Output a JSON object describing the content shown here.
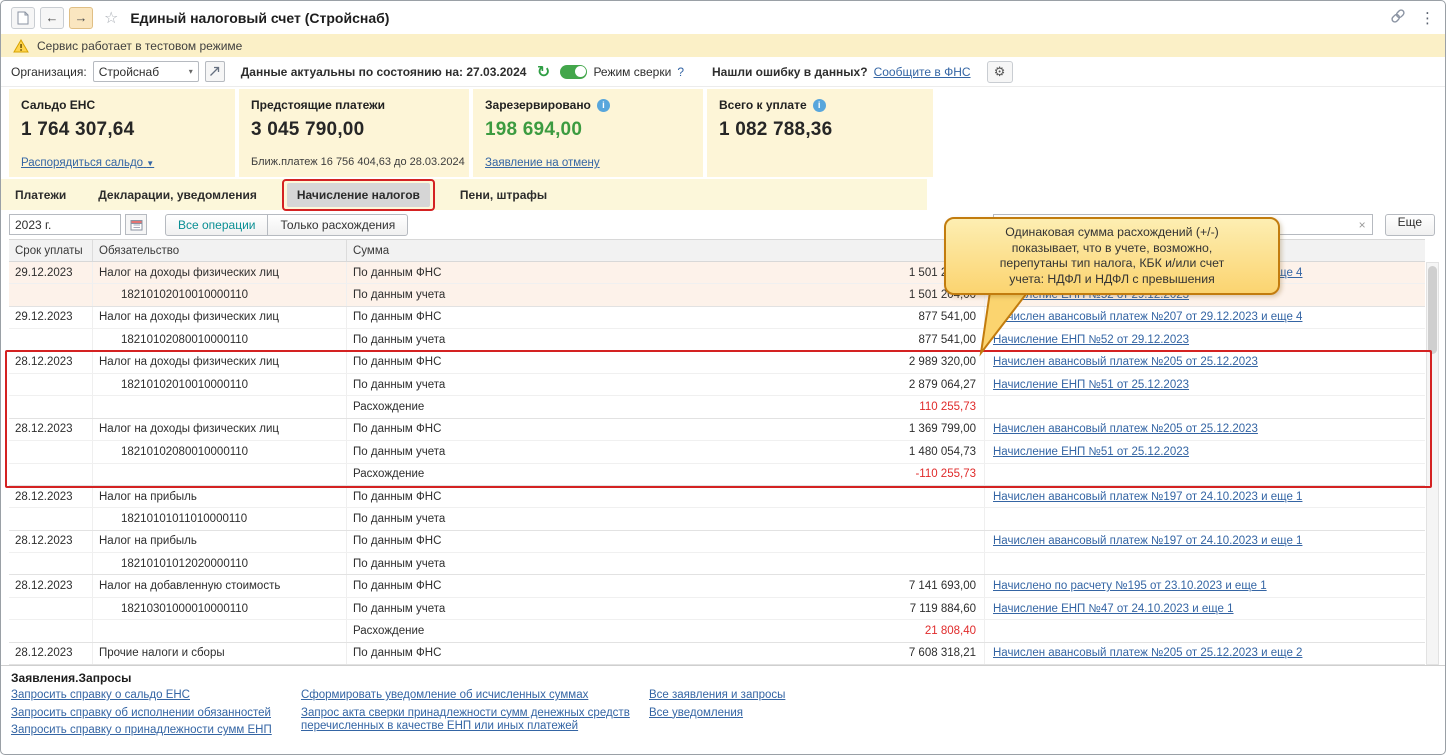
{
  "titlebar": {
    "title": "Единый налоговый счет (Стройснаб)"
  },
  "warning": {
    "text": "Сервис работает в тестовом режиме"
  },
  "toolbar": {
    "org_label": "Организация:",
    "org_value": "Стройснаб",
    "actuality_label": "Данные актуальны по состоянию на:",
    "actuality_date": "27.03.2024",
    "reconciliation_label": "Режим сверки",
    "reconciliation_help": "?",
    "error_question": "Нашли ошибку в данных?",
    "error_link": "Сообщите в ФНС"
  },
  "cards": {
    "balance": {
      "title": "Сальдо ЕНС",
      "value": "1 764 307,64",
      "action": "Распорядиться сальдо"
    },
    "upcoming": {
      "title": "Предстоящие платежи",
      "value": "3 045 790,00",
      "note": "Ближ.платеж 16 756 404,63 до 28.03.2024"
    },
    "reserved": {
      "title": "Зарезервировано",
      "value": "198 694,00",
      "action": "Заявление на отмену",
      "value_color": "#3c9b40"
    },
    "total": {
      "title": "Всего к уплате",
      "value": "1 082 788,36"
    }
  },
  "tabs": {
    "items": [
      "Платежи",
      "Декларации, уведомления",
      "Начисление налогов",
      "Пени, штрафы"
    ],
    "selected": "Начисление налогов"
  },
  "filters": {
    "period": "2023 г.",
    "all_operations": "Все операции",
    "only_differences": "Только расхождения",
    "search_value": "",
    "more_button": "Еще"
  },
  "table": {
    "columns": {
      "due": "Срок уплаты",
      "obligation": "Обязательство",
      "sum": "Сумма"
    },
    "groups": [
      {
        "date": "29.12.2023",
        "name": "Налог на доходы физических лиц",
        "kbk": "18210102010010000110",
        "rows": [
          {
            "label": "По данным ФНС",
            "amount": "1 501 204,00",
            "doc": "Начислен авансовый платеж №207 от 29.12.2023 и еще 4"
          },
          {
            "label": "По данным учета",
            "amount": "1 501 204,00",
            "doc": "Начисление ЕНП №52 от 29.12.2023"
          }
        ]
      },
      {
        "date": "29.12.2023",
        "name": "Налог на доходы физических лиц",
        "kbk": "18210102080010000110",
        "rows": [
          {
            "label": "По данным ФНС",
            "amount": "877 541,00",
            "doc": "Начислен авансовый платеж №207 от 29.12.2023 и еще 4"
          },
          {
            "label": "По данным учета",
            "amount": "877 541,00",
            "doc": "Начисление ЕНП №52 от 29.12.2023"
          }
        ]
      },
      {
        "date": "28.12.2023",
        "name": "Налог на доходы физических лиц",
        "kbk": "18210102010010000110",
        "rows": [
          {
            "label": "По данным ФНС",
            "amount": "2 989 320,00",
            "doc": "Начислен авансовый платеж №205 от 25.12.2023"
          },
          {
            "label": "По данным учета",
            "amount": "2 879 064,27",
            "doc": "Начисление ЕНП №51 от 25.12.2023"
          },
          {
            "label": "Расхождение",
            "amount": "110 255,73",
            "doc": "",
            "diff": true
          }
        ]
      },
      {
        "date": "28.12.2023",
        "name": "Налог на доходы физических лиц",
        "kbk": "18210102080010000110",
        "rows": [
          {
            "label": "По данным ФНС",
            "amount": "1 369 799,00",
            "doc": "Начислен авансовый платеж №205 от 25.12.2023"
          },
          {
            "label": "По данным учета",
            "amount": "1 480 054,73",
            "doc": "Начисление ЕНП №51 от 25.12.2023"
          },
          {
            "label": "Расхождение",
            "amount": "-110 255,73",
            "doc": "",
            "diff": true
          }
        ]
      },
      {
        "date": "28.12.2023",
        "name": "Налог на прибыль",
        "kbk": "18210101011010000110",
        "rows": [
          {
            "label": "По данным ФНС",
            "amount": "",
            "doc": "Начислен авансовый платеж №197 от 24.10.2023 и еще 1"
          },
          {
            "label": "По данным учета",
            "amount": "",
            "doc": ""
          }
        ]
      },
      {
        "date": "28.12.2023",
        "name": "Налог на прибыль",
        "kbk": "18210101012020000110",
        "rows": [
          {
            "label": "По данным ФНС",
            "amount": "",
            "doc": "Начислен авансовый платеж №197 от 24.10.2023 и еще 1"
          },
          {
            "label": "По данным учета",
            "amount": "",
            "doc": ""
          }
        ]
      },
      {
        "date": "28.12.2023",
        "name": "Налог на добавленную стоимость",
        "kbk": "18210301000010000110",
        "rows": [
          {
            "label": "По данным ФНС",
            "amount": "7 141 693,00",
            "doc": "Начислено по расчету №195 от 23.10.2023 и еще 1"
          },
          {
            "label": "По данным учета",
            "amount": "7 119 884,60",
            "doc": "Начисление ЕНП №47 от 24.10.2023 и еще 1"
          },
          {
            "label": "Расхождение",
            "amount": "21 808,40",
            "doc": "",
            "diff": true
          }
        ]
      },
      {
        "date": "28.12.2023",
        "name": "Прочие налоги и сборы",
        "kbk": "",
        "rows": [
          {
            "label": "По данным ФНС",
            "amount": "7 608 318,21",
            "doc": "Начислен авансовый платеж №205 от 25.12.2023 и еще 2"
          }
        ]
      }
    ]
  },
  "callout": {
    "text": "Одинаковая сумма расхождений (+/-) показывает, что в учете, возможно, перепутаны тип налога, КБК и/или счет учета: НДФЛ и НДФЛ с превышения"
  },
  "footer": {
    "title": "Заявления.Запросы",
    "col1": [
      "Запросить справку о сальдо ЕНС",
      "Запросить справку об исполнении обязанностей",
      "Запросить справку о принадлежности сумм ЕНП"
    ],
    "col2": [
      "Сформировать уведомление об исчисленных суммах",
      "Запрос акта сверки принадлежности сумм денежных средств перечисленных в качестве ЕНП или иных платежей"
    ],
    "col3": [
      "Все заявления и запросы",
      "Все уведомления"
    ]
  }
}
